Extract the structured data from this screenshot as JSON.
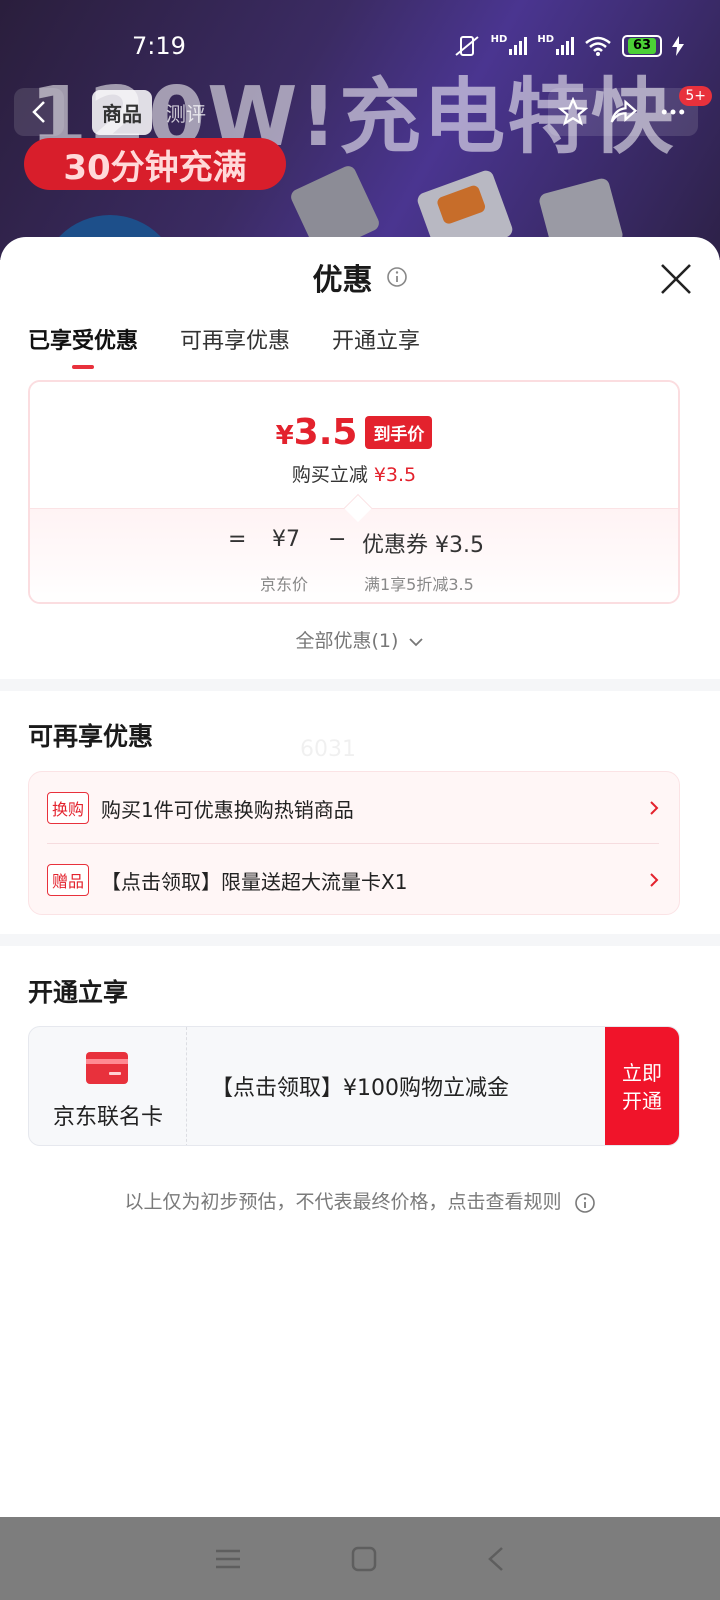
{
  "status_bar": {
    "time": "7:19",
    "battery": "63",
    "network_labels": [
      "HD",
      "HD"
    ]
  },
  "background": {
    "headline": "120W!充电特快",
    "badge": "30分钟充满",
    "nav_tabs": [
      "商品",
      "测评"
    ],
    "notification_badge": "5+"
  },
  "sheet": {
    "title": "优惠",
    "tabs": [
      "已享受优惠",
      "可再享优惠",
      "开通立享"
    ],
    "price_card": {
      "currency": "¥",
      "price": "3.5",
      "price_tag": "到手价",
      "discount_label": "购买立减",
      "discount_value": "¥3.5",
      "equals": "=",
      "jd_price": "¥7",
      "jd_price_label": "京东价",
      "minus": "−",
      "coupon": "优惠券 ¥3.5",
      "coupon_rule": "满1享5折减3.5"
    },
    "all_discounts": "全部优惠(1)",
    "section_more": {
      "title": "可再享优惠",
      "items": [
        {
          "tag": "换购",
          "text": "购买1件可优惠换购热销商品"
        },
        {
          "tag": "赠品",
          "text": "【点击领取】限量送超大流量卡X1"
        }
      ]
    },
    "section_open": {
      "title": "开通立享",
      "card_name": "京东联名卡",
      "card_text": "【点击领取】¥100购物立减金",
      "button": "立即开通"
    },
    "disclaimer": "以上仅为初步预估，不代表最终价格，点击查看规则",
    "watermark": "6031"
  },
  "colors": {
    "accent": "#e3222d",
    "card_icon": "#e8313c"
  }
}
